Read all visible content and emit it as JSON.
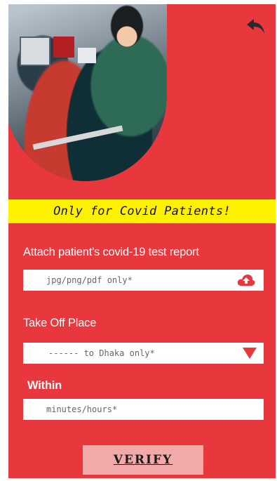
{
  "banner": {
    "text": "Only for Covid Patients!"
  },
  "report": {
    "label": "Attach patient's covid-19 test report",
    "placeholder": "jpg/png/pdf only*",
    "icon": "cloud-upload-icon"
  },
  "takeoff": {
    "label": "Take Off Place",
    "placeholder": "------ to Dhaka only*",
    "icon": "dropdown-triangle-icon"
  },
  "within": {
    "label": "Within",
    "placeholder": "minutes/hours*"
  },
  "verify": {
    "label": "VERIFY"
  },
  "header": {
    "back_icon": "back-arrow-icon"
  },
  "colors": {
    "background": "#e8383d",
    "banner": "#fff200",
    "button": "#f1aaa9"
  }
}
